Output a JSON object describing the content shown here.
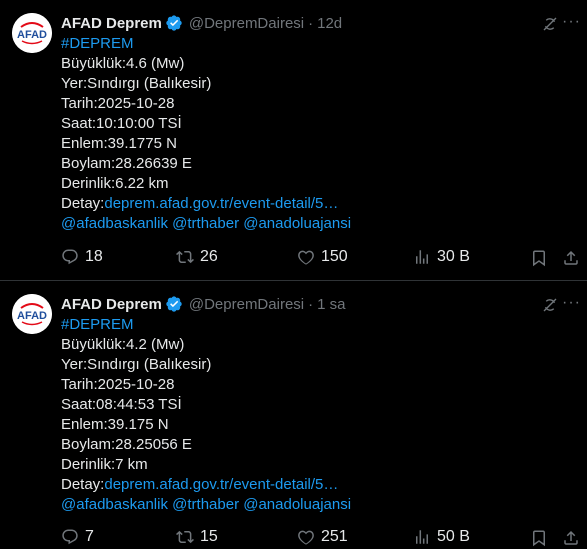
{
  "tweets": [
    {
      "author": "AFAD Deprem",
      "handle": "@DepremDairesi",
      "time": "12d",
      "hashtag": "#DEPREM",
      "buyukluk": "Büyüklük:4.6 (Mw)",
      "yer": "Yer:Sındırgı (Balıkesir)",
      "tarih": "Tarih:2025-10-28",
      "saat": "Saat:10:10:00 TSİ",
      "enlem": "Enlem:39.1775 N",
      "boylam": "Boylam:28.26639 E",
      "derinlik": "Derinlik:6.22 km",
      "detay_label": "Detay:",
      "detay_link": "deprem.afad.gov.tr/event-detail/5…",
      "mentions": [
        "@afadbaskanlik",
        "@trthaber",
        "@anadoluajansi"
      ],
      "replies": "18",
      "retweets": "26",
      "likes": "150",
      "views": "30 B"
    },
    {
      "author": "AFAD Deprem",
      "handle": "@DepremDairesi",
      "time": "1 sa",
      "hashtag": "#DEPREM",
      "buyukluk": "Büyüklük:4.2 (Mw)",
      "yer": "Yer:Sındırgı (Balıkesir)",
      "tarih": "Tarih:2025-10-28",
      "saat": "Saat:08:44:53 TSİ",
      "enlem": "Enlem:39.175 N",
      "boylam": "Boylam:28.25056 E",
      "derinlik": "Derinlik:7 km",
      "detay_label": "Detay:",
      "detay_link": "deprem.afad.gov.tr/event-detail/5…",
      "mentions": [
        "@afadbaskanlik",
        "@trthaber",
        "@anadoluajansi"
      ],
      "replies": "7",
      "retweets": "15",
      "likes": "251",
      "views": "50 B"
    }
  ],
  "logo_text": "AFAD",
  "colors": {
    "background": "#000000",
    "text": "#e7e9ea",
    "muted": "#71767b",
    "link": "#1d9bf0",
    "verified": "#1d9bf0",
    "logo_red": "#e30a17",
    "logo_blue": "#1f4e9c"
  },
  "icons": [
    "afad-logo",
    "verified-badge-icon",
    "grok-icon",
    "more-icon",
    "reply-icon",
    "retweet-icon",
    "like-icon",
    "views-icon",
    "bookmark-icon",
    "share-icon"
  ]
}
